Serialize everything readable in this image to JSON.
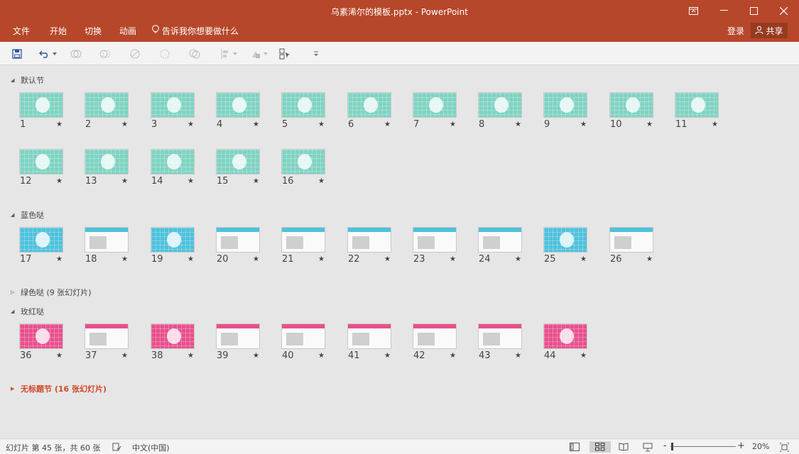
{
  "window": {
    "title": "乌素浠尔的模板.pptx - PowerPoint",
    "controls": [
      "ribbon-display-icon",
      "minimize-icon",
      "maximize-icon",
      "close-icon"
    ]
  },
  "ribbon": {
    "tabs": [
      "文件",
      "开始",
      "切换",
      "动画"
    ],
    "tell_me": "告诉我你想要做什么",
    "login": "登录",
    "share": "共享"
  },
  "qat": {
    "icons": [
      "save-icon",
      "undo-icon",
      "undo-dropdown-icon",
      "shape-union-icon",
      "shape-combine-icon",
      "shape-fragment-icon",
      "shape-intersect-icon",
      "shape-subtract-icon",
      "align-icon",
      "align-dropdown-icon",
      "arrange-icon",
      "arrange-dropdown-icon",
      "select-pane-icon",
      "customize-qat-icon"
    ]
  },
  "sections": [
    {
      "name": "默认节",
      "collapsed": false,
      "slides": [
        {
          "n": "1",
          "style": "teal"
        },
        {
          "n": "2",
          "style": "teal"
        },
        {
          "n": "3",
          "style": "teal"
        },
        {
          "n": "4",
          "style": "teal"
        },
        {
          "n": "5",
          "style": "teal"
        },
        {
          "n": "6",
          "style": "teal"
        },
        {
          "n": "7",
          "style": "teal"
        },
        {
          "n": "8",
          "style": "teal"
        },
        {
          "n": "9",
          "style": "teal"
        },
        {
          "n": "10",
          "style": "teal"
        },
        {
          "n": "11",
          "style": "teal"
        },
        {
          "n": "12",
          "style": "teal"
        },
        {
          "n": "13",
          "style": "teal"
        },
        {
          "n": "14",
          "style": "teal"
        },
        {
          "n": "15",
          "style": "teal"
        },
        {
          "n": "16",
          "style": "teal"
        }
      ]
    },
    {
      "name": "蓝色哒",
      "collapsed": false,
      "slides": [
        {
          "n": "17",
          "style": "cyan"
        },
        {
          "n": "18",
          "style": "white"
        },
        {
          "n": "19",
          "style": "cyan"
        },
        {
          "n": "20",
          "style": "white"
        },
        {
          "n": "21",
          "style": "white"
        },
        {
          "n": "22",
          "style": "white"
        },
        {
          "n": "23",
          "style": "white"
        },
        {
          "n": "24",
          "style": "white"
        },
        {
          "n": "25",
          "style": "cyan"
        },
        {
          "n": "26",
          "style": "white"
        }
      ]
    },
    {
      "name": "绿色哒 (9 张幻灯片)",
      "collapsed": true,
      "slides": []
    },
    {
      "name": "玫红哒",
      "collapsed": false,
      "slides": [
        {
          "n": "36",
          "style": "pink"
        },
        {
          "n": "37",
          "style": "white"
        },
        {
          "n": "38",
          "style": "pink"
        },
        {
          "n": "39",
          "style": "white"
        },
        {
          "n": "40",
          "style": "white"
        },
        {
          "n": "41",
          "style": "white"
        },
        {
          "n": "42",
          "style": "white"
        },
        {
          "n": "43",
          "style": "white"
        },
        {
          "n": "44",
          "style": "pink"
        }
      ]
    },
    {
      "name": "无标题节 (16 张幻灯片)",
      "collapsed": true,
      "highlight": true,
      "slides": []
    }
  ],
  "star_glyph": "★",
  "statusbar": {
    "slide_info": "幻灯片 第 45 张，共 60 张",
    "language": "中文(中国)",
    "zoom": "20%",
    "zoom_minus": "-",
    "zoom_plus": "+"
  },
  "colors": {
    "brand": "#b7472a",
    "teal": "#7fd3c2",
    "cyan": "#4fc1dc",
    "pink": "#e8508d",
    "section_highlight": "#d24726"
  }
}
